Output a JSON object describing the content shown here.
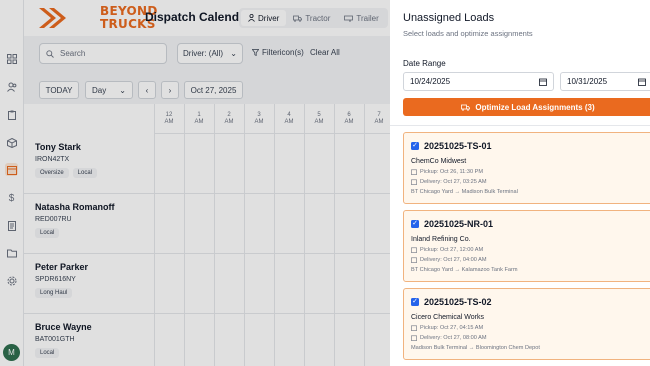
{
  "header": {
    "brand_line1": "BEYOND",
    "brand_line2": "TRUCKS",
    "title": "Dispatch Calendar",
    "view_tabs": [
      {
        "label": "Driver",
        "icon": "user-icon",
        "active": true
      },
      {
        "label": "Tractor",
        "icon": "truck-icon",
        "active": false
      },
      {
        "label": "Trailer",
        "icon": "trailer-icon",
        "active": false
      }
    ]
  },
  "toolbar": {
    "search_placeholder": "Search",
    "driver_filter": "Driver: (All)",
    "filter_label": "Filtericon(s)",
    "clear_all": "Clear All"
  },
  "datenav": {
    "today": "TODAY",
    "view": "Day",
    "date": "Oct 27, 2025"
  },
  "calendar": {
    "hours": [
      {
        "h": "12",
        "p": "AM"
      },
      {
        "h": "1",
        "p": "AM"
      },
      {
        "h": "2",
        "p": "AM"
      },
      {
        "h": "3",
        "p": "AM"
      },
      {
        "h": "4",
        "p": "AM"
      },
      {
        "h": "5",
        "p": "AM"
      },
      {
        "h": "6",
        "p": "AM"
      },
      {
        "h": "7",
        "p": "AM"
      }
    ],
    "drivers": [
      {
        "name": "Tony Stark",
        "code": "IRON42TX",
        "tags": [
          "Oversize",
          "Local"
        ]
      },
      {
        "name": "Natasha Romanoff",
        "code": "RED007RU",
        "tags": [
          "Local"
        ]
      },
      {
        "name": "Peter Parker",
        "code": "SPDR616NY",
        "tags": [
          "Long Haul"
        ]
      },
      {
        "name": "Bruce Wayne",
        "code": "BAT001GTH",
        "tags": [
          "Local"
        ]
      }
    ]
  },
  "sidebar": {
    "icons": [
      "grid-icon",
      "users-icon",
      "clipboard-icon",
      "package-icon",
      "calendar-icon",
      "dollar-icon",
      "receipt-icon",
      "folder-icon",
      "gear-icon"
    ],
    "avatar_initial": "M",
    "accent_color": "#ea6a1f"
  },
  "panel": {
    "title": "Unassigned Loads",
    "subtitle": "Select loads and optimize assignments",
    "date_range_label": "Date Range",
    "start_date": "10/24/2025",
    "end_date": "10/31/2025",
    "optimize_button": "Optimize Load Assignments (3)",
    "loads": [
      {
        "id": "20251025-TS-01",
        "customer": "ChemCo Midwest",
        "pickup": "Pickup: Oct 26, 11:30 PM",
        "delivery": "Delivery: Oct 27, 03:25 AM",
        "route": "BT Chicago Yard → Madison Bulk Terminal",
        "checked": true
      },
      {
        "id": "20251025-NR-01",
        "customer": "Inland Refining Co.",
        "pickup": "Pickup: Oct 27, 12:00 AM",
        "delivery": "Delivery: Oct 27, 04:00 AM",
        "route": "BT Chicago Yard → Kalamazoo Tank Farm",
        "checked": true
      },
      {
        "id": "20251025-TS-02",
        "customer": "Cicero Chemical Works",
        "pickup": "Pickup: Oct 27, 04:15 AM",
        "delivery": "Delivery: Oct 27, 08:00 AM",
        "route": "Madison Bulk Terminal → Bloomington Chem Depot",
        "checked": true
      }
    ]
  }
}
